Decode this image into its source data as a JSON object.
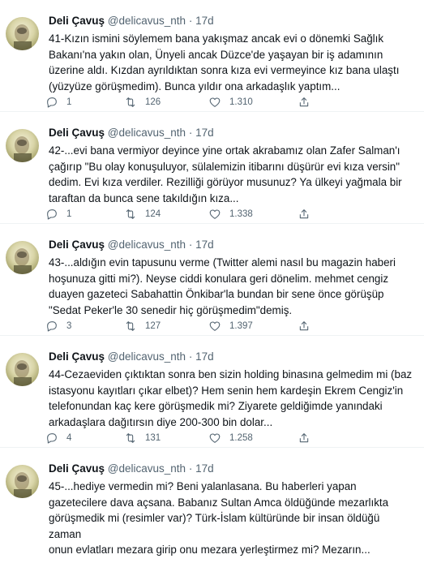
{
  "tweets": [
    {
      "name": "Deli Çavuş",
      "handle": "@delicavus_nth",
      "dot": "·",
      "time": "17d",
      "text": "41-Kızın ismini söylemem bana yakışmaz ancak evi o dönemki Sağlık\nBakanı'na yakın olan, Ünyeli ancak Düzce'de yaşayan bir iş adamının\nüzerine aldı. Kızdan ayrıldıktan sonra kıza evi vermeyince kız bana ulaştı\n(yüzyüze görüşmedim). Bunca yıldır ona arkadaşlık yaptım...",
      "replies": "1",
      "retweets": "126",
      "likes": "1.310"
    },
    {
      "name": "Deli Çavuş",
      "handle": "@delicavus_nth",
      "dot": "·",
      "time": "17d",
      "text": "42-...evi bana vermiyor deyince yine ortak akrabamız olan Zafer Salman'ı\nçağırıp \"Bu olay konuşuluyor, sülalemizin itibarını düşürür evi kıza versin\"\ndedim. Evi kıza verdiler. Rezilliği görüyor musunuz? Ya ülkeyi yağmala bir\ntaraftan da bunca sene takıldığın kıza...",
      "replies": "1",
      "retweets": "124",
      "likes": "1.338"
    },
    {
      "name": "Deli Çavuş",
      "handle": "@delicavus_nth",
      "dot": "·",
      "time": "17d",
      "text": "43-...aldığın evin tapusunu verme (Twitter alemi nasıl bu magazin haberi\nhoşunuza gitti mi?). Neyse ciddi konulara geri dönelim. mehmet cengiz\nduayen gazeteci Sabahattin Önkibar'la bundan bir sene önce görüşüp\n\"Sedat Peker'le 30 senedir hiç görüşmedim\"demiş.",
      "replies": "3",
      "retweets": "127",
      "likes": "1.397"
    },
    {
      "name": "Deli Çavuş",
      "handle": "@delicavus_nth",
      "dot": "·",
      "time": "17d",
      "text": "44-Cezaeviden çıktıktan sonra ben sizin holding binasına gelmedim mi (baz\nistasyonu kayıtları çıkar elbet)? Hem senin hem kardeşin Ekrem Cengiz'in\ntelefonundan kaç kere görüşmedik mi? Ziyarete geldiğimde yanındaki\narkadaşlara dağıtırsın diye 200-300 bin dolar...",
      "replies": "4",
      "retweets": "131",
      "likes": "1.258"
    },
    {
      "name": "Deli Çavuş",
      "handle": "@delicavus_nth",
      "dot": "·",
      "time": "17d",
      "text": "45-...hediye vermedin mi? Beni yalanlasana. Bu haberleri yapan\ngazetecilere dava açsana. Babanız Sultan Amca öldüğünde mezarlıkta\ngörüşmedik mi (resimler var)? Türk-İslam kültüründe bir insan öldüğü zaman\nonun evlatları mezara girip onu mezara yerleştirmez mi? Mezarın...",
      "replies": "",
      "retweets": "",
      "likes": ""
    }
  ],
  "icons": {
    "reply": "reply-icon",
    "retweet": "retweet-icon",
    "like": "heart-icon",
    "share": "share-icon"
  },
  "colors": {
    "text": "#0f1419",
    "secondary": "#536471",
    "divider": "#eff3f4"
  }
}
